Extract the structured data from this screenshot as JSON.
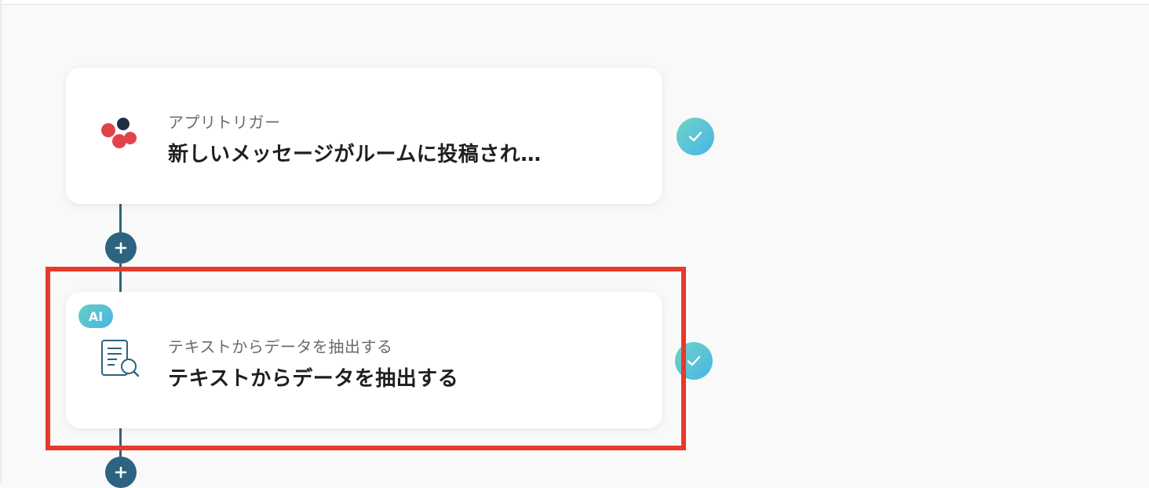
{
  "flow": {
    "steps": [
      {
        "subtitle": "アプリトリガー",
        "title": "新しいメッセージがルームに投稿され…",
        "icon": "chatwork-logo-icon",
        "status": "completed"
      },
      {
        "badge": "AI",
        "subtitle": "テキストからデータを抽出する",
        "title": "テキストからデータを抽出する",
        "icon": "document-search-icon",
        "status": "completed",
        "highlighted": true
      }
    ],
    "add_step_icon": "plus-icon",
    "status_icon": "check-icon"
  },
  "colors": {
    "connector": "#2d6380",
    "highlight": "#e8392a",
    "check_gradient": [
      "#6fd3c6",
      "#47b6e6"
    ],
    "logo_red": "#e2434b",
    "logo_dark": "#1f2e45"
  }
}
